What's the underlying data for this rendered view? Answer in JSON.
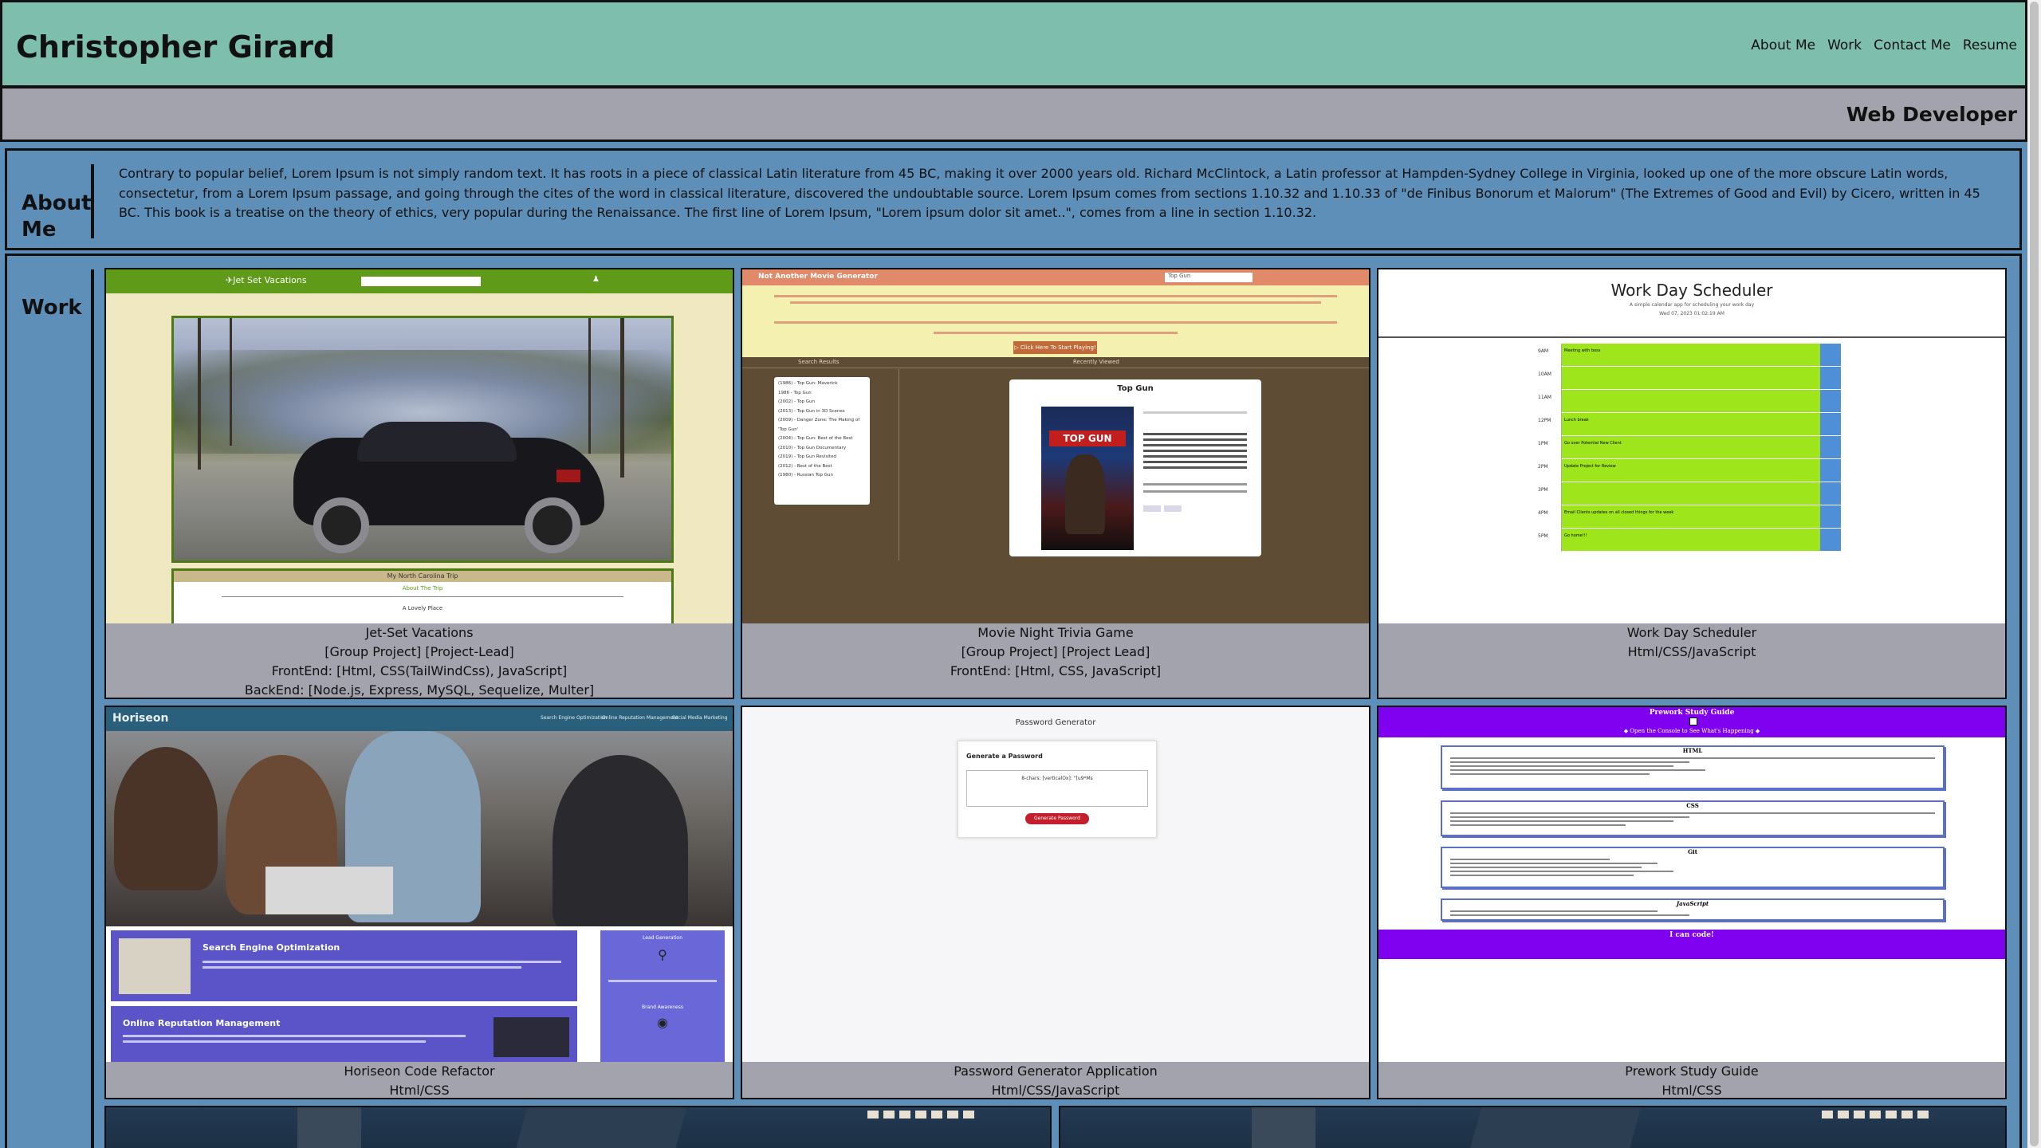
{
  "header": {
    "name": "Christopher Girard",
    "nav": [
      "About Me",
      "Work",
      "Contact Me",
      "Resume"
    ],
    "role": "Web Developer"
  },
  "about": {
    "heading_line1": "About",
    "heading_line2": "Me",
    "text": "Contrary to popular belief, Lorem Ipsum is not simply random text. It has roots in a piece of classical Latin literature from 45 BC, making it over 2000 years old. Richard McClintock, a Latin professor at Hampden-Sydney College in Virginia, looked up one of the more obscure Latin words, consectetur, from a Lorem Ipsum passage, and going through the cites of the word in classical literature, discovered the undoubtable source. Lorem Ipsum comes from sections 1.10.32 and 1.10.33 of \"de Finibus Bonorum et Malorum\" (The Extremes of Good and Evil) by Cicero, written in 45 BC. This book is a treatise on the theory of ethics, very popular during the Renaissance. The first line of Lorem Ipsum, \"Lorem ipsum dolor sit amet..\", comes from a line in section 1.10.32."
  },
  "work": {
    "heading": "Work",
    "projects": [
      {
        "title": "Jet-Set Vacations",
        "line2": "[Group Project] [Project-Lead]",
        "line3": "FrontEnd: [Html, CSS(TailWindCss), JavaScript]",
        "line4": "BackEnd: [Node.js, Express, MySQL, Sequelize, Multer]",
        "shot": {
          "brand": "✈Jet Set Vacations",
          "trip": "My North Carolina Trip",
          "about": "About The Trip",
          "place": "A Lovely Place"
        }
      },
      {
        "title": "Movie Night Trivia Game",
        "line2": "[Group Project] [Project Lead]",
        "line3": "FrontEnd: [Html, CSS, JavaScript]",
        "shot": {
          "brand": "Not Another Movie Generator",
          "search_placeholder": "Top Gun",
          "cta": "▷ Click Here To Start Playing!",
          "results_label": "Search Results",
          "recent_label": "Recently Viewed",
          "movie_title": "Top Gun",
          "results": [
            "(1986) - Top Gun: Maverick",
            "1986 - Top Gun",
            "(2002) - Top Gun",
            "(2013) - Top Gun in 3D Scenes",
            "(2009) - Danger Zone: The Making of 'Top Gun'",
            "(2004) - Top Gun: Best of the Best",
            "(2010) - Top Gun Documentary",
            "(2019) - Top Gun Revisited",
            "(2012) - Best of the Best",
            "(1980) - Russian Top Gun"
          ]
        }
      },
      {
        "title": "Work Day Scheduler",
        "line2": "Html/CSS/JavaScript",
        "shot": {
          "title": "Work Day Scheduler",
          "subtitle": "A simple calendar app for scheduling your work day",
          "date": "Wed 07, 2023 01:02:19 AM",
          "hours": [
            "9AM",
            "10AM",
            "11AM",
            "12PM",
            "1PM",
            "2PM",
            "3PM",
            "4PM",
            "5PM"
          ],
          "tasks": [
            "Meeting with boss",
            "",
            "",
            "Lunch break",
            "Go over Potential New Client",
            "Update Project for Review",
            "",
            "Email Clients updates on all closed things for the week",
            "Go home!!!"
          ]
        }
      },
      {
        "title": "Horiseon Code Refactor",
        "line2": "Html/CSS",
        "shot": {
          "brand": "Horiseon",
          "nav": [
            "Search Engine Optimization",
            "Online Reputation Management",
            "Social Media Marketing"
          ],
          "seo": "Search Engine Optimization",
          "orm": "Online Reputation Management",
          "lead": "Lead Generation",
          "brand_aw": "Brand Awareness"
        }
      },
      {
        "title": "Password Generator Application",
        "line2": "Html/CSS/JavaScript",
        "shot": {
          "title": "Password Generator",
          "card_title": "Generate a Password",
          "placeholder": "8-chars: [verticalOx]: \"[u9*Ms",
          "button": "Generate Password"
        }
      },
      {
        "title": "Prework Study Guide",
        "line2": "Html/CSS",
        "shot": {
          "title": "Prework Study Guide",
          "console": "◆ Open the Console to See What's Happening ◆",
          "sections": [
            "HTML",
            "CSS",
            "Git",
            "JavaScript"
          ],
          "footer": "I can code!"
        }
      }
    ]
  },
  "colors": {
    "header_bg": "#7dbfac",
    "subheader_bg": "#a2a3ac",
    "page_bg": "#5e8fb8",
    "card_caption_bg": "#a2a3ac"
  }
}
